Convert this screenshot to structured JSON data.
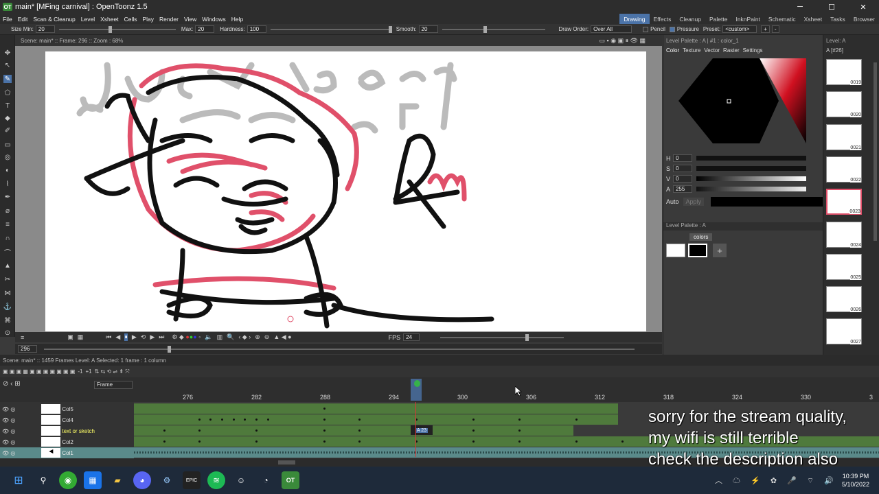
{
  "window": {
    "title": "main* [MFing carnival] : OpenToonz 1.5",
    "logo": "OT",
    "minimize": "─",
    "maximize": "☐",
    "close": "✕"
  },
  "menu": [
    "File",
    "Edit",
    "Scan & Cleanup",
    "Level",
    "Xsheet",
    "Cells",
    "Play",
    "Render",
    "View",
    "Windows",
    "Help"
  ],
  "rooms": [
    "Drawing",
    "Effects",
    "Cleanup",
    "Palette",
    "InknPaint",
    "Schematic",
    "Xsheet",
    "Tasks",
    "Browser"
  ],
  "tool_options": {
    "size_min_label": "Size Min:",
    "size_min": "20",
    "max_label": "Max:",
    "max": "20",
    "hardness_label": "Hardness:",
    "hardness": "100",
    "smooth_label": "Smooth:",
    "smooth": "20",
    "draw_order_label": "Draw Order:",
    "draw_order": "Over All",
    "pencil_label": "Pencil",
    "pressure_label": "Pressure",
    "preset_label": "Preset:",
    "preset": "<custom>",
    "plus": "+",
    "minus": "-"
  },
  "viewer": {
    "info": "Scene: main*  ::  Frame: 296  ::  Zoom : 68%"
  },
  "playback": {
    "fps_label": "FPS",
    "fps": "24",
    "frame": "296"
  },
  "palette": {
    "title": "Level Palette : A | #1 : color_1",
    "tabs": [
      "Color",
      "Texture",
      "Vector",
      "Raster",
      "Settings"
    ],
    "h_label": "H",
    "h": "0",
    "s_label": "S",
    "s": "0",
    "v_label": "V",
    "v": "0",
    "a_label": "A",
    "a": "255",
    "auto": "Auto",
    "apply": "Apply",
    "level_palette": "Level Palette : A",
    "colors_tab": "colors",
    "plus": "+"
  },
  "level_strip": {
    "title": "Level: A",
    "level": "A  [#26]",
    "frames": [
      "0019",
      "0020",
      "0021",
      "0022",
      "0023",
      "0024",
      "0025",
      "0026",
      "0027"
    ]
  },
  "status": {
    "text": "Scene: main*  ::  1459 Frames  Level: A  Selected: 1 frame : 1 column"
  },
  "xsheet": {
    "frame_label": "Frame",
    "ruler": [
      "276",
      "282",
      "288",
      "294",
      "300",
      "306",
      "312",
      "318",
      "324",
      "330",
      "3"
    ],
    "minus1": "-1",
    "plus1": "+1",
    "layers": [
      "Col5",
      "Col4",
      "text or sketch",
      "Col2",
      "Col1"
    ],
    "current_cell": "A 23"
  },
  "overlay": [
    "sorry for the stream quality,",
    "my wifi is still terrible",
    "check the description also"
  ],
  "clock": {
    "time": "10:39 PM",
    "date": "5/10/2022"
  },
  "colors": {
    "accent": "#4b73a8",
    "track_green": "#4f7a3c",
    "canvas_red": "#e0506a"
  }
}
